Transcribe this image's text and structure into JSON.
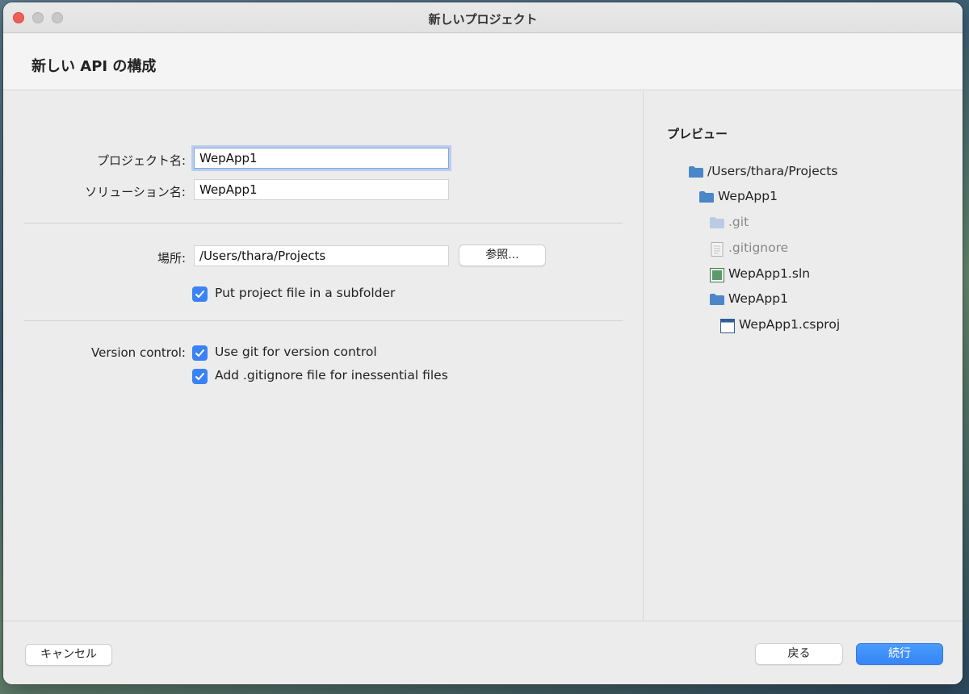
{
  "window": {
    "title": "新しいプロジェクト"
  },
  "header": {
    "title": "新しい API の構成"
  },
  "form": {
    "project_name_label": "プロジェクト名:",
    "project_name_value": "WepApp1",
    "solution_name_label": "ソリューション名:",
    "solution_name_value": "WepApp1",
    "location_label": "場所:",
    "location_value": "/Users/thara/Projects",
    "browse_label": "参照...",
    "subfolder_label": "Put project file in a subfolder",
    "subfolder_checked": true,
    "version_control_label": "Version control:",
    "use_git_label": "Use git for version control",
    "use_git_checked": true,
    "gitignore_label": "Add .gitignore file for inessential files",
    "gitignore_checked": true
  },
  "preview": {
    "title": "プレビュー",
    "tree": [
      {
        "label": "/Users/thara/Projects",
        "icon": "folder-icon",
        "dim": false
      },
      {
        "label": "WepApp1",
        "icon": "folder-icon",
        "dim": false
      },
      {
        "label": ".git",
        "icon": "folder-icon",
        "dim": true
      },
      {
        "label": ".gitignore",
        "icon": "file-icon",
        "dim": true
      },
      {
        "label": "WepApp1.sln",
        "icon": "solution-icon",
        "dim": false
      },
      {
        "label": "WepApp1",
        "icon": "folder-icon",
        "dim": false
      },
      {
        "label": "WepApp1.csproj",
        "icon": "project-icon",
        "dim": false
      }
    ]
  },
  "footer": {
    "cancel_label": "キャンセル",
    "back_label": "戻る",
    "continue_label": "続行"
  },
  "colors": {
    "accent": "#3b82f6",
    "folder": "#4a86c8",
    "folder_dim": "#b8cde3"
  }
}
